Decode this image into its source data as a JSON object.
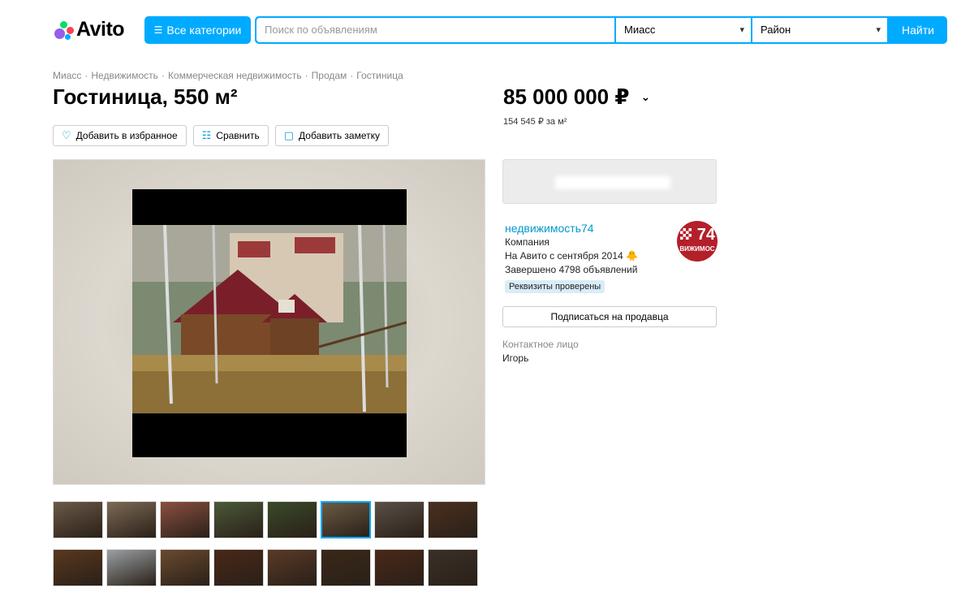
{
  "header": {
    "logo_text": "Avito",
    "categories_label": "Все категории",
    "search_placeholder": "Поиск по объявлениям",
    "city": "Миасс",
    "district": "Район",
    "find_label": "Найти"
  },
  "breadcrumb": [
    "Миасс",
    "Недвижимость",
    "Коммерческая недвижимость",
    "Продам",
    "Гостиница"
  ],
  "breadcrumb_sep": "·",
  "title": "Гостиница, 550 м²",
  "actions": {
    "favorite": "Добавить в избранное",
    "compare": "Сравнить",
    "note": "Добавить заметку"
  },
  "price": {
    "value": "85 000 000 ₽",
    "per_meter": "154 545 ₽ за м²"
  },
  "seller": {
    "name": "недвижимость74",
    "type": "Компания",
    "since": "На Авито с сентября 2014 🐥",
    "completed": "Завершено 4798 объявлений",
    "verified": "Реквизиты проверены",
    "avatar_number": "74",
    "avatar_text": "ВИЖИМОС",
    "subscribe": "Подписаться на продавца",
    "contact_label": "Контактное лицо",
    "contact_name": "Игорь"
  },
  "colors": {
    "accent": "#00aaff",
    "link": "#0099cc",
    "avatar_bg": "#b3202a",
    "verified_bg": "#d8edf8"
  },
  "thumbnails": {
    "row1": [
      "#6a5a48",
      "#7d6a55",
      "#8a5040",
      "#4a5a38",
      "#3a4a2a",
      "#6b5b45",
      "#5a5048",
      "#4a3020"
    ],
    "row2": [
      "#5a3820",
      "#9aa0a4",
      "#6a4a30",
      "#4a2818",
      "#5a3a28",
      "#3a2818",
      "#4a2818",
      "#3a3028"
    ],
    "active_index": 5
  }
}
